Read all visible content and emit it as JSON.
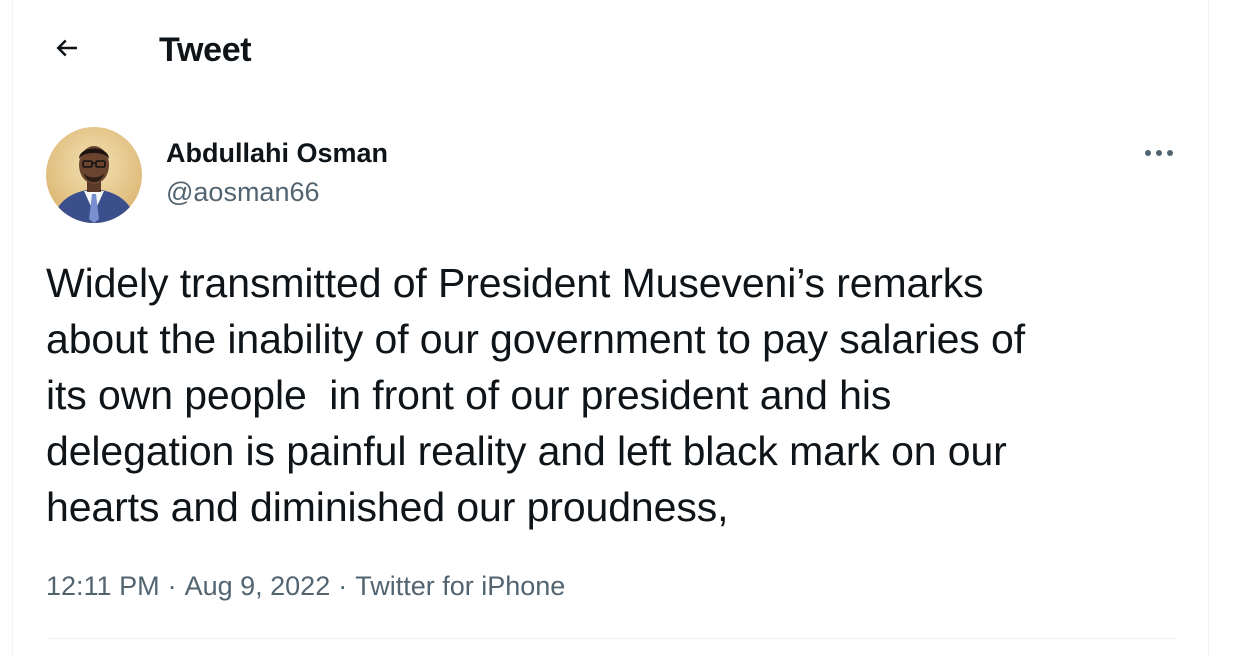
{
  "header": {
    "title": "Tweet",
    "back_icon": "arrow-left-icon"
  },
  "tweet": {
    "author": {
      "name": "Abdullahi Osman",
      "handle": "@aosman66",
      "avatar_icon": "profile-photo"
    },
    "more_icon": "ellipsis-icon",
    "text": "Widely transmitted of President Museveni’s remarks\nabout the inability of our government to pay salaries of\nits own people  in front of our president and his\ndelegation is painful reality and left black mark on our\nhearts and diminished our proudness,",
    "time": "12:11 PM",
    "date": "Aug 9, 2022",
    "source": "Twitter for iPhone",
    "separator": "·"
  },
  "colors": {
    "text_primary": "#0f1419",
    "text_secondary": "#536471",
    "border": "#eff3f4"
  }
}
